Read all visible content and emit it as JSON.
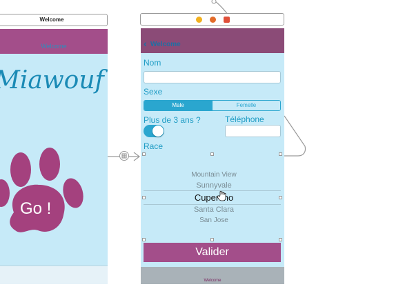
{
  "left_scene": {
    "scene_title": "Welcome",
    "nav_title": "Welcome",
    "brand_text": "Miawouf",
    "go_button_label": "Go !"
  },
  "right_scene": {
    "back_label": "Welcome",
    "name_label": "Nom",
    "name_value": "",
    "sex_label": "Sexe",
    "sex_options": [
      "Male",
      "Femelle"
    ],
    "sex_selected": "Male",
    "age_label": "Plus de 3 ans ?",
    "age_toggle_on": true,
    "phone_label": "Téléphone",
    "phone_value": "",
    "breed_label": "Race",
    "picker_items": [
      "Mountain View",
      "Sunnyvale",
      "Cupertino",
      "Santa Clara",
      "San Jose"
    ],
    "picker_selected": "Cupertino",
    "submit_label": "Valider",
    "tab_label": "Welcome"
  },
  "colors": {
    "accent_magenta": "#a34e8a",
    "accent_blue": "#2aa6cf",
    "background_light_blue": "#c6eaf8"
  },
  "icons": [
    "segue-icon",
    "view-controller-icon",
    "first-responder-icon",
    "exit-icon",
    "hand-cursor-icon",
    "back-chevron-icon"
  ]
}
